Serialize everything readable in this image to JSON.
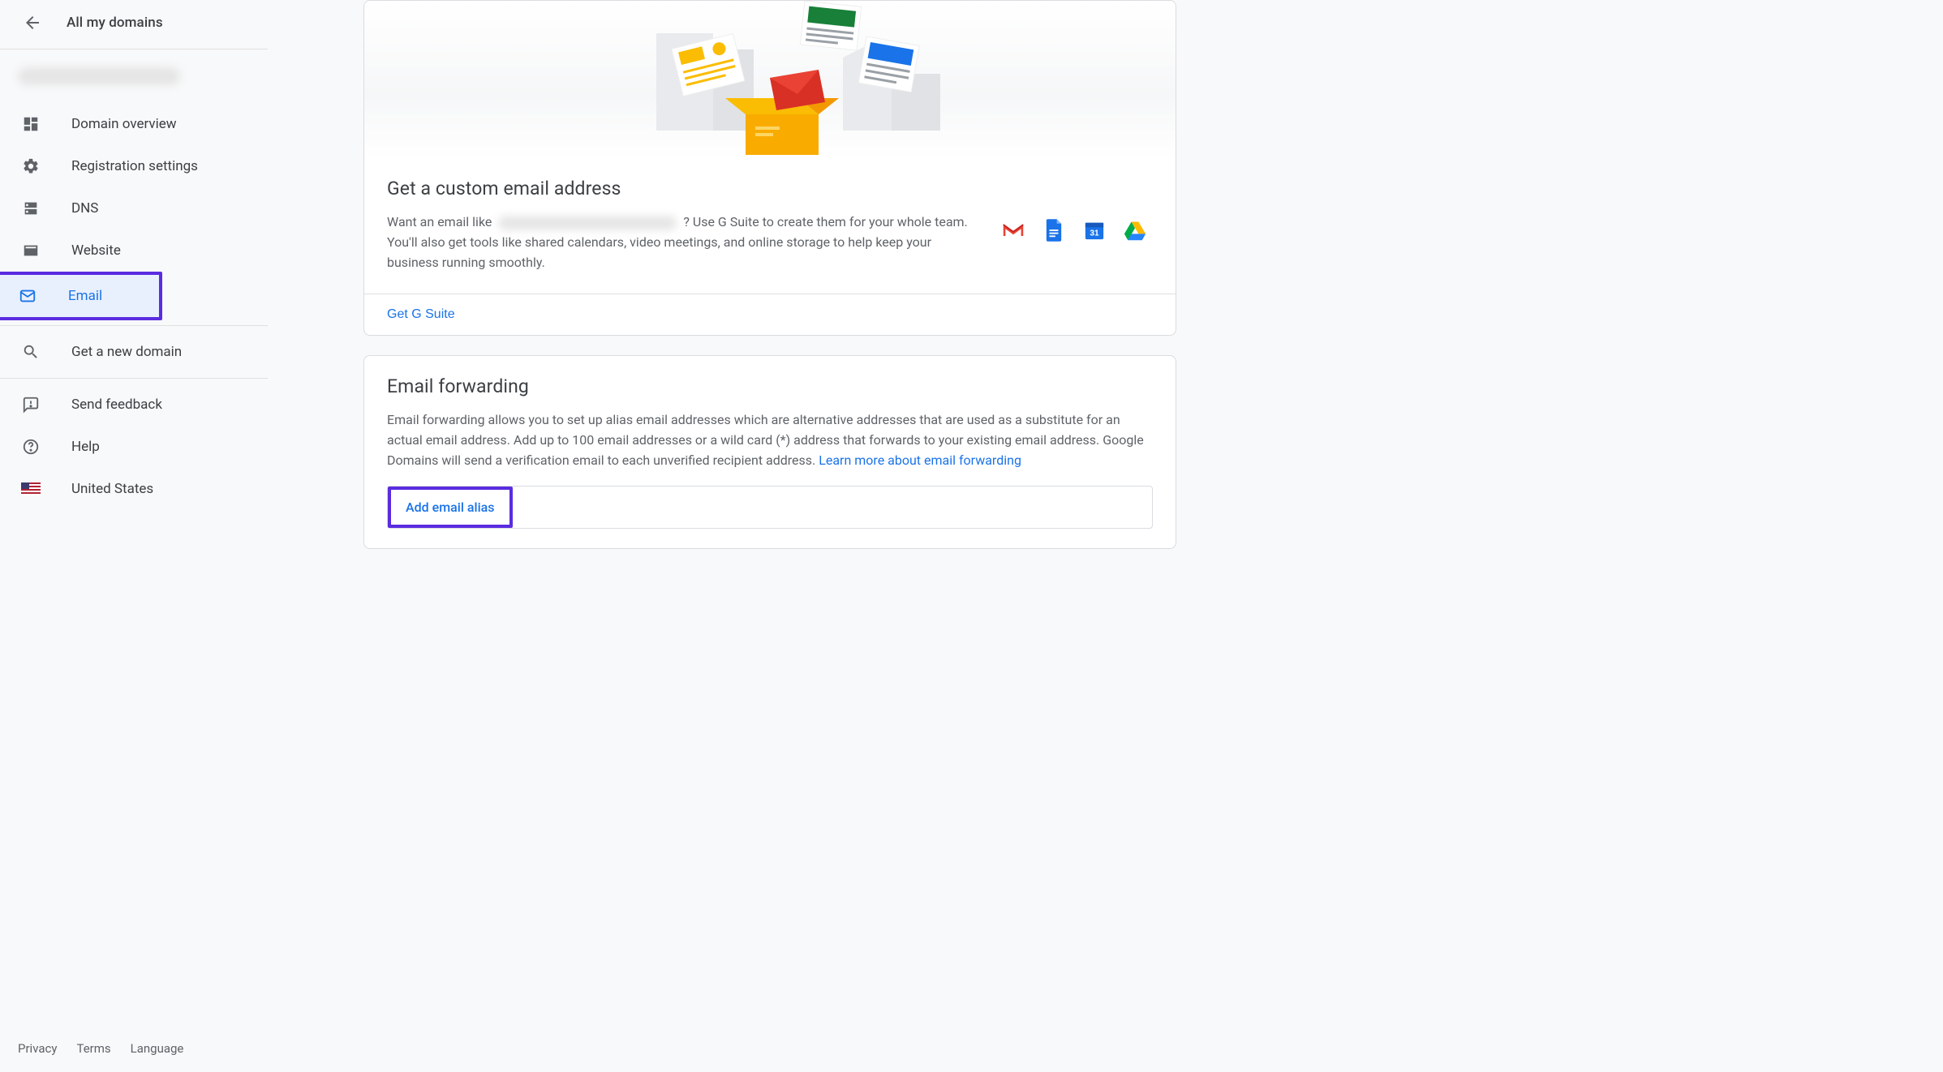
{
  "sidebar": {
    "title": "All my domains",
    "items": [
      {
        "label": "Domain overview"
      },
      {
        "label": "Registration settings"
      },
      {
        "label": "DNS"
      },
      {
        "label": "Website"
      },
      {
        "label": "Email"
      },
      {
        "label": "Get a new domain"
      },
      {
        "label": "Send feedback"
      },
      {
        "label": "Help"
      },
      {
        "label": "United States"
      }
    ],
    "footer": {
      "privacy": "Privacy",
      "terms": "Terms",
      "language": "Language"
    }
  },
  "custom_email": {
    "title": "Get a custom email address",
    "text_pre": "Want an email like ",
    "text_post": "? Use G Suite to create them for your whole team. You'll also get tools like shared calendars, video meetings, and online storage to help keep your business running smoothly.",
    "action": "Get G Suite"
  },
  "forwarding": {
    "title": "Email forwarding",
    "text": "Email forwarding allows you to set up alias email addresses which are alternative addresses that are used as a substitute for an actual email address. Add up to 100 email addresses or a wild card (*) address that forwards to your existing email address. Google Domains will send a verification email to each unverified recipient address. ",
    "learn_more": "Learn more about email forwarding",
    "add_alias": "Add email alias"
  }
}
